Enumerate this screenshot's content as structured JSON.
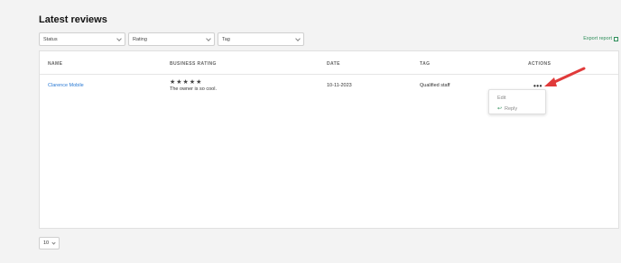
{
  "page": {
    "title": "Latest reviews"
  },
  "filters": [
    {
      "label": "Status"
    },
    {
      "label": "Rating"
    },
    {
      "label": "Tag"
    }
  ],
  "export_label": "Export report",
  "table": {
    "headers": [
      "NAME",
      "BUSINESS RATING",
      "DATE",
      "TAG",
      "ACTIONS"
    ],
    "rows": [
      {
        "name": "Clarence Mobile",
        "stars": "★★★★★",
        "rating_value": 5,
        "comment": "The owner is so cool.",
        "date": "10-11-2023",
        "tag": "Qualified staff",
        "actions": "•••"
      }
    ]
  },
  "actions_menu": {
    "edit": "Edit",
    "reply": "Reply"
  },
  "pagination": {
    "page_size": "10"
  },
  "colors": {
    "accent": "#2f8f5b",
    "link": "#2a7ad4",
    "annotation_arrow": "#e03a3a"
  }
}
